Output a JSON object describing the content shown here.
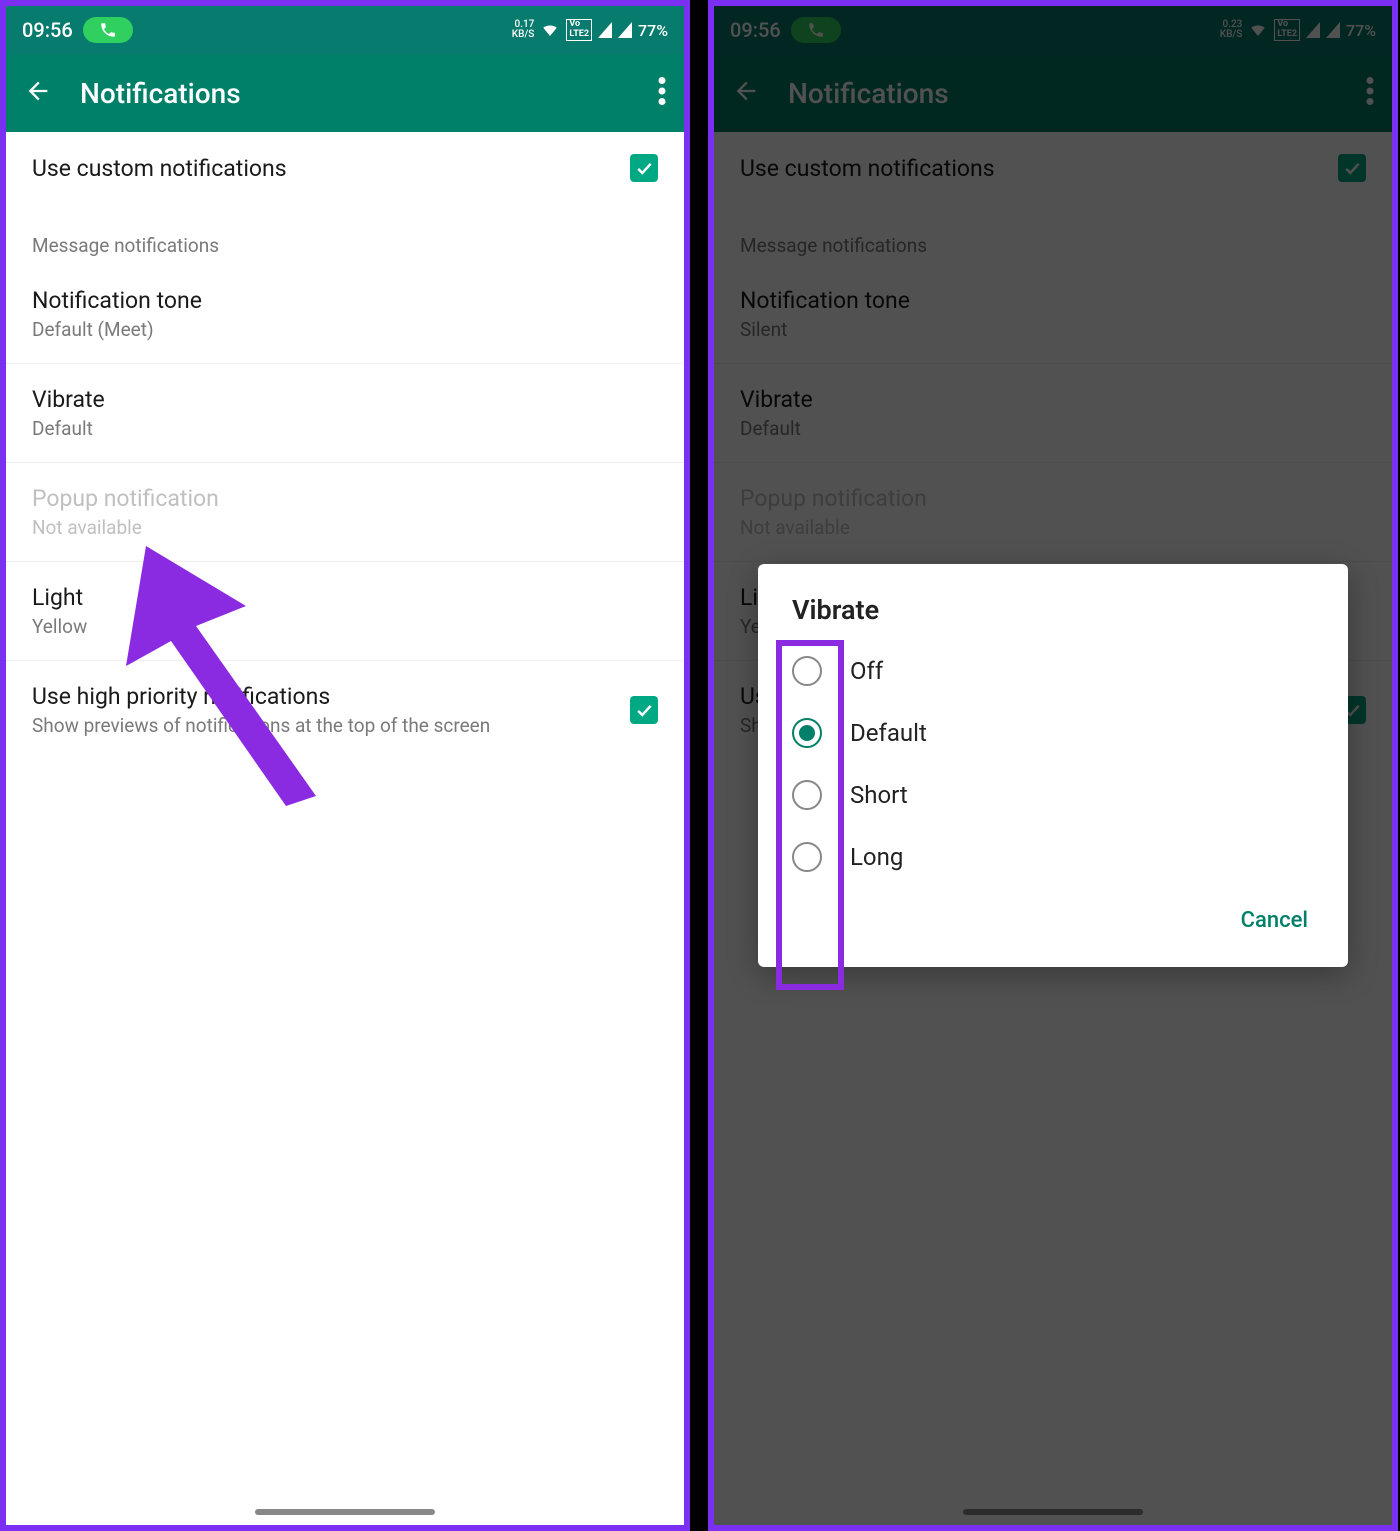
{
  "left": {
    "status": {
      "time": "09:56",
      "rate": "0.17",
      "rate_unit": "KB/S",
      "net": "LTE2",
      "battery": "77%"
    },
    "appbar": {
      "title": "Notifications"
    },
    "custom": {
      "label": "Use custom notifications"
    },
    "section": "Message notifications",
    "tone": {
      "title": "Notification tone",
      "value": "Default (Meet)"
    },
    "vibrate": {
      "title": "Vibrate",
      "value": "Default"
    },
    "popup": {
      "title": "Popup notification",
      "value": "Not available"
    },
    "light": {
      "title": "Light",
      "value": "Yellow"
    },
    "hp": {
      "title": "Use high priority notifications",
      "sub": "Show previews of notifications at the top of the screen"
    }
  },
  "right": {
    "status": {
      "time": "09:56",
      "rate": "0.23",
      "rate_unit": "KB/S",
      "net": "LTE2",
      "battery": "77%"
    },
    "appbar": {
      "title": "Notifications"
    },
    "custom": {
      "label": "Use custom notifications"
    },
    "section": "Message notifications",
    "tone": {
      "title": "Notification tone",
      "value": "Silent"
    },
    "vibrate": {
      "title": "Vibrate",
      "value": "Default"
    },
    "popup": {
      "title": "Popup notification",
      "value": "Not available"
    },
    "light": {
      "title": "Light",
      "value": "Yellow"
    },
    "hp": {
      "title": "Use high priority notifications",
      "sub": "Show previews of notifications at the top of the screen"
    },
    "dialog": {
      "title": "Vibrate",
      "options": [
        "Off",
        "Default",
        "Short",
        "Long"
      ],
      "selected": 1,
      "cancel": "Cancel"
    }
  }
}
